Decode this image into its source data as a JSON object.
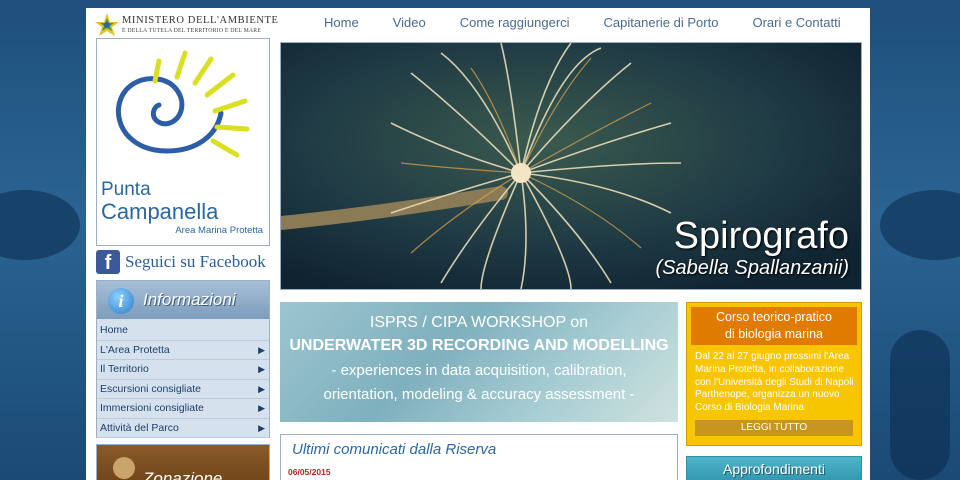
{
  "header": {
    "ministry_title": "MINISTERO DELL'AMBIENTE",
    "ministry_subtitle": "E DELLA TUTELA DEL TERRITORIO E DEL MARE"
  },
  "nav": {
    "items": [
      "Home",
      "Video",
      "Come raggiungerci",
      "Capitanerie di Porto",
      "Orari e Contatti"
    ]
  },
  "logo": {
    "name_line1": "Punta",
    "name_line2": "Campanella",
    "subtitle": "Area Marina Protetta"
  },
  "facebook": {
    "label": "Seguici su Facebook",
    "icon": "facebook-icon"
  },
  "info": {
    "title": "Informazioni",
    "icon": "info-icon",
    "menu": [
      {
        "label": "Home",
        "has_submenu": false
      },
      {
        "label": "L'Area Protetta",
        "has_submenu": true
      },
      {
        "label": "Il Territorio",
        "has_submenu": true
      },
      {
        "label": "Escursioni consigliate",
        "has_submenu": true
      },
      {
        "label": "Immersioni consigliate",
        "has_submenu": true
      },
      {
        "label": "Attività del Parco",
        "has_submenu": true
      }
    ]
  },
  "zonazione": {
    "title": "Zonazione",
    "icon": "pin-icon"
  },
  "hero": {
    "caption": "Spirografo",
    "caption_latin": "(Sabella Spallanzanii)"
  },
  "workshop": {
    "line1": "ISPRS / CIPA WORKSHOP on",
    "line2": "UNDERWATER 3D RECORDING AND MODELLING",
    "line3": "- experiences in data acquisition, calibration,",
    "line4": "orientation, modeling & accuracy assessment -"
  },
  "news": {
    "title": "Ultimi comunicati dalla Riserva",
    "date": "06/05/2015",
    "text": ""
  },
  "course": {
    "title_line1": "Corso teorico-pratico",
    "title_line2": "di biologia marina",
    "body": "Dal 22 al 27 giugno prossimi l'Area Marina Protetta, in collaborazione con l'Università degli Studi di Napoli Parthenope, organizza un nuovo Corso di Biologia Marina",
    "button": "LEGGI TUTTO"
  },
  "approfondimenti": {
    "title": "Approfondimenti"
  },
  "colors": {
    "link_blue": "#2a67a2",
    "course_yellow": "#f7c600",
    "course_orange": "#e07b00",
    "date_red": "#b5231d"
  }
}
